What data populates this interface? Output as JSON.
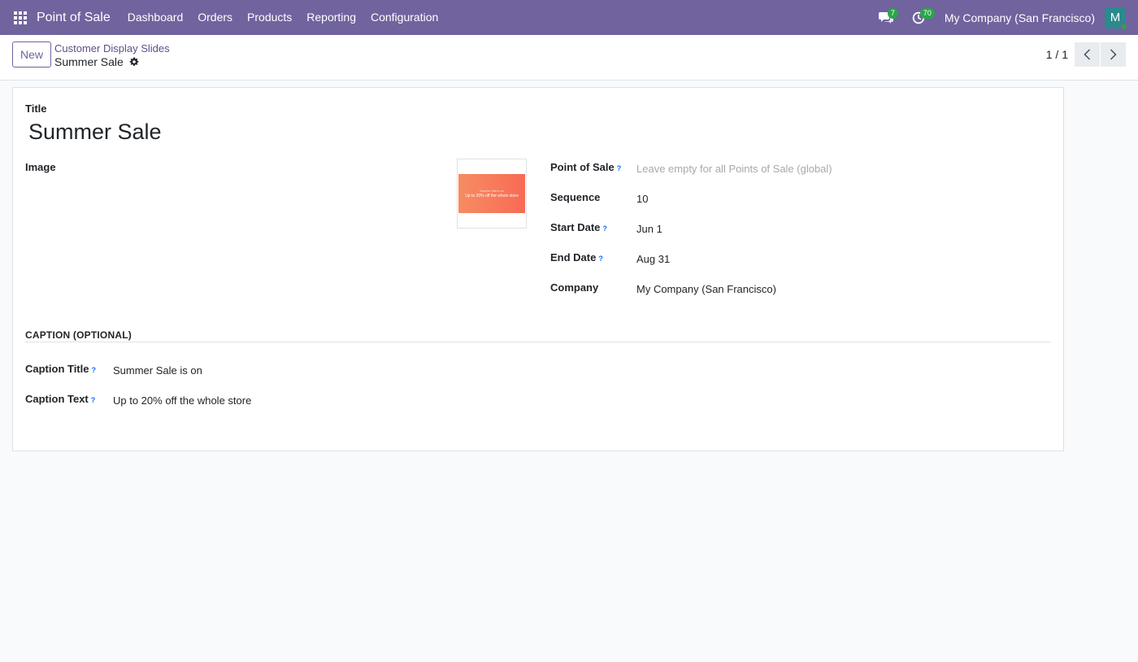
{
  "navbar": {
    "app_title": "Point of Sale",
    "menu": [
      "Dashboard",
      "Orders",
      "Products",
      "Reporting",
      "Configuration"
    ],
    "messages_count": "7",
    "activities_count": "70",
    "company": "My Company (San Francisco)",
    "avatar_initial": "M"
  },
  "control_panel": {
    "new_label": "New",
    "breadcrumb_parent": "Customer Display Slides",
    "breadcrumb_current": "Summer Sale",
    "pager_value": "1 / 1"
  },
  "form": {
    "title_label": "Title",
    "title_value": "Summer Sale",
    "image_label": "Image",
    "image_banner_small": "Summer Sale is on",
    "image_banner_text": "Up to 20% off the whole store",
    "fields": {
      "pos": {
        "label": "Point of Sale",
        "placeholder": "Leave empty for all Points of Sale (global)"
      },
      "sequence": {
        "label": "Sequence",
        "value": "10"
      },
      "start_date": {
        "label": "Start Date",
        "value": "Jun 1"
      },
      "end_date": {
        "label": "End Date",
        "value": "Aug 31"
      },
      "company": {
        "label": "Company",
        "value": "My Company (San Francisco)"
      }
    },
    "caption_section": "CAPTION (OPTIONAL)",
    "caption_title": {
      "label": "Caption Title",
      "value": "Summer Sale is on"
    },
    "caption_text": {
      "label": "Caption Text",
      "value": "Up to 20% off the whole store"
    },
    "help_mark": "?"
  },
  "colors": {
    "navbar": "#71639e",
    "link": "#5e4f8c",
    "badge": "#28a745",
    "help": "#0d6efd"
  }
}
